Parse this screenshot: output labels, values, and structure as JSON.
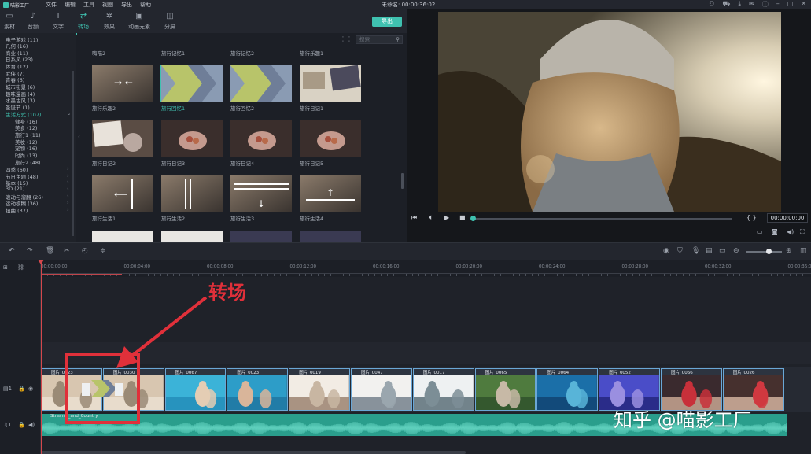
{
  "app": {
    "logo_text": "喵影工厂",
    "menu": [
      "文件",
      "编辑",
      "工具",
      "视图",
      "导出",
      "帮助"
    ],
    "doc_title": "未命名: 00:00:36:02",
    "window_icons": [
      "user-icon",
      "cart-icon",
      "download-icon",
      "mail-icon",
      "info-icon",
      "minimize-icon",
      "maximize-icon",
      "close-icon"
    ]
  },
  "tabs": [
    {
      "label": "素材",
      "icon": "folder-icon",
      "active": false
    },
    {
      "label": "音频",
      "icon": "music-icon",
      "active": false
    },
    {
      "label": "文字",
      "icon": "text-icon",
      "active": false
    },
    {
      "label": "转场",
      "icon": "transition-icon",
      "active": true
    },
    {
      "label": "效果",
      "icon": "effects-icon",
      "active": false
    },
    {
      "label": "动画元素",
      "icon": "elements-icon",
      "active": false
    },
    {
      "label": "分屏",
      "icon": "splitscreen-icon",
      "active": false
    }
  ],
  "export_label": "导出",
  "sidebar": {
    "items": [
      {
        "label": "电子游戏 (11)",
        "sub": false,
        "active": false,
        "arrow": ""
      },
      {
        "label": "几何 (16)",
        "sub": false,
        "active": false,
        "arrow": ""
      },
      {
        "label": "商业 (11)",
        "sub": false,
        "active": false,
        "arrow": ""
      },
      {
        "label": "日系风 (23)",
        "sub": false,
        "active": false,
        "arrow": ""
      },
      {
        "label": "体育 (12)",
        "sub": false,
        "active": false,
        "arrow": ""
      },
      {
        "label": "武侠 (7)",
        "sub": false,
        "active": false,
        "arrow": ""
      },
      {
        "label": "青春 (6)",
        "sub": false,
        "active": false,
        "arrow": ""
      },
      {
        "label": "城市街景 (6)",
        "sub": false,
        "active": false,
        "arrow": ""
      },
      {
        "label": "趣味漫画 (4)",
        "sub": false,
        "active": false,
        "arrow": ""
      },
      {
        "label": "水墨古风 (3)",
        "sub": false,
        "active": false,
        "arrow": ""
      },
      {
        "label": "圣诞节 (1)",
        "sub": false,
        "active": false,
        "arrow": ""
      },
      {
        "label": "生活方式 (107)",
        "sub": false,
        "active": true,
        "arrow": "⌄"
      },
      {
        "label": "健身 (16)",
        "sub": true,
        "active": false,
        "arrow": ""
      },
      {
        "label": "美食 (12)",
        "sub": true,
        "active": false,
        "arrow": ""
      },
      {
        "label": "旅行1 (11)",
        "sub": true,
        "active": false,
        "arrow": ""
      },
      {
        "label": "美妆 (12)",
        "sub": true,
        "active": false,
        "arrow": ""
      },
      {
        "label": "宠物 (16)",
        "sub": true,
        "active": false,
        "arrow": ""
      },
      {
        "label": "时尚 (13)",
        "sub": true,
        "active": false,
        "arrow": ""
      },
      {
        "label": "旅行2 (48)",
        "sub": true,
        "active": false,
        "arrow": ""
      },
      {
        "label": "四季 (60)",
        "sub": false,
        "active": false,
        "arrow": "›"
      },
      {
        "label": "节日主题 (48)",
        "sub": false,
        "active": false,
        "arrow": "›"
      },
      {
        "label": "基本 (15)",
        "sub": false,
        "active": false,
        "arrow": "›"
      },
      {
        "label": "3D (21)",
        "sub": false,
        "active": false,
        "arrow": "›"
      },
      {
        "label": "滚动与溜翻 (26)",
        "sub": false,
        "active": false,
        "arrow": "›"
      },
      {
        "label": "运动模糊 (36)",
        "sub": false,
        "active": false,
        "arrow": "›"
      },
      {
        "label": "扭曲 (37)",
        "sub": false,
        "active": false,
        "arrow": "›"
      }
    ]
  },
  "library": {
    "search_placeholder": "搜索",
    "row0_labels": [
      "嗨喵2",
      "旅行记忆1",
      "旅行记忆2",
      "旅行乐趣1"
    ],
    "items": [
      {
        "label": "旅行乐趣2",
        "style": "arrows",
        "active": false
      },
      {
        "label": "旅行回忆1",
        "style": "chevron",
        "active": true
      },
      {
        "label": "旅行回忆2",
        "style": "chevron",
        "active": false
      },
      {
        "label": "旅行日记1",
        "style": "photo",
        "active": false
      },
      {
        "label": "旅行日记2",
        "style": "photo2",
        "active": false
      },
      {
        "label": "旅行日记3",
        "style": "hands",
        "active": false
      },
      {
        "label": "旅行日记4",
        "style": "hands",
        "active": false
      },
      {
        "label": "旅行日记5",
        "style": "hands",
        "active": false
      },
      {
        "label": "旅行生活1",
        "style": "arrowleft",
        "active": false
      },
      {
        "label": "旅行生活2",
        "style": "lines",
        "active": false
      },
      {
        "label": "旅行生活3",
        "style": "arrowdown",
        "active": false
      },
      {
        "label": "旅行生活4",
        "style": "arrowup",
        "active": false
      }
    ]
  },
  "preview": {
    "timecode": "00:00:00:00",
    "progress": 0.0
  },
  "timeline": {
    "ruler_labels": [
      "00:00:00:00",
      "00:00:04:00",
      "00:00:08:00",
      "00:00:12:00",
      "00:00:16:00",
      "00:00:20:00",
      "00:00:24:00",
      "00:00:28:00",
      "00:00:32:00",
      "00:00:36:00"
    ],
    "clips": [
      {
        "label": "图片_0023",
        "palette": "warm"
      },
      {
        "label": "图片_0030",
        "palette": "warm"
      },
      {
        "label": "图片_0067",
        "palette": "pool"
      },
      {
        "label": "图片_0023",
        "palette": "pool2"
      },
      {
        "label": "图片_0019",
        "palette": "bright"
      },
      {
        "label": "图片_0047",
        "palette": "yoga"
      },
      {
        "label": "图片_0017",
        "palette": "yoga2"
      },
      {
        "label": "图片_0065",
        "palette": "green"
      },
      {
        "label": "图片_0064",
        "palette": "aqua"
      },
      {
        "label": "图片_0052",
        "palette": "purple"
      },
      {
        "label": "图片_0066",
        "palette": "red"
      },
      {
        "label": "图片_0026",
        "palette": "red2"
      }
    ],
    "audio_label": "Streams_and_Country"
  },
  "annotation": {
    "text": "转场"
  },
  "watermark": "知乎 @喵影工厂",
  "colors": {
    "accent": "#3fc1b0",
    "annotation": "#e0303a",
    "playhead": "#d4474c",
    "audio": "#2a9e8c"
  }
}
